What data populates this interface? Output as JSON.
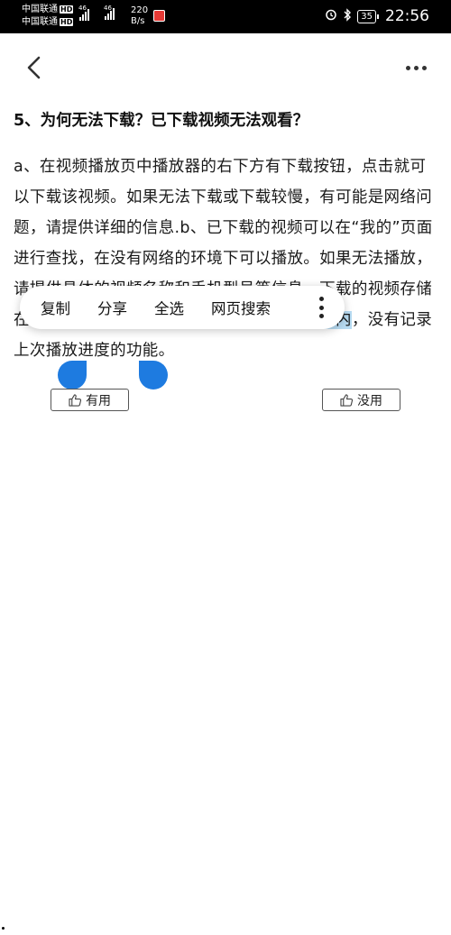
{
  "status_bar": {
    "carrier1": "中国联通",
    "carrier2": "中国联通",
    "hd_badge": "HD",
    "network1": "46",
    "network2": "46",
    "speed_value": "220",
    "speed_unit": "B/s",
    "battery": "35",
    "time": "22:56"
  },
  "header": {
    "back_icon": "chevron-left-icon",
    "more_icon": "more-horizontal-icon"
  },
  "question": {
    "title": "5、为何无法下载？已下载视频无法观看？"
  },
  "answer": {
    "part1": "a、在视频播放页中播放器的右下方有下载按钮，点击就可以下载该视频。如果无法下载或下载较慢，有可能是网络问题，请提供详细的信息.b、已下载的视频可以在“我的”页面进行查找，在没有网络的环境下可以播放。如果无法播放，请提供具体的视频名称和手机型号等信息。下载的视频存储在手机中，请确认下载视频存储在你个人",
    "selected": "手里内",
    "part2": "，没有记录上次播放进度的功能。"
  },
  "context_menu": {
    "items": [
      "复制",
      "分享",
      "全选",
      "网页搜索"
    ],
    "more_icon": "more-vertical-icon"
  },
  "feedback": {
    "useful_label": "有用",
    "useless_label": "没用",
    "icon": "thumbs-up-icon"
  }
}
